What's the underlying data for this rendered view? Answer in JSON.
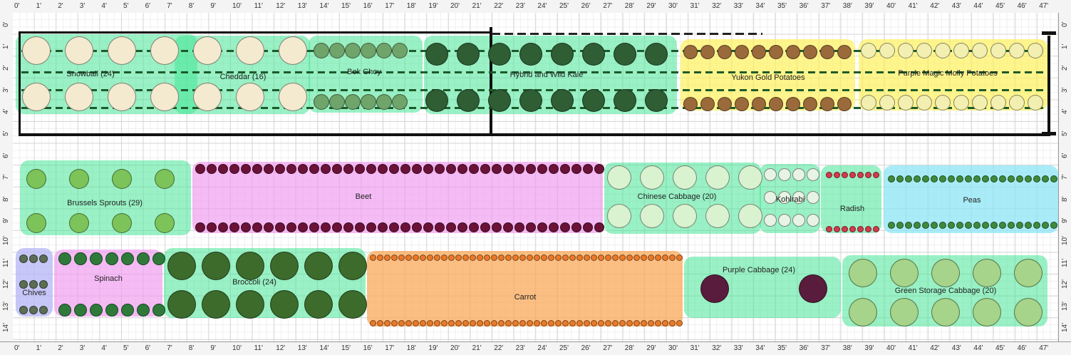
{
  "rulers": {
    "top": [
      "0'",
      "1'",
      "2'",
      "3'",
      "4'",
      "5'",
      "6'",
      "7'",
      "8'",
      "9'",
      "10'",
      "11'",
      "12'",
      "13'",
      "14'",
      "15'",
      "16'",
      "17'",
      "18'",
      "19'",
      "20'",
      "21'",
      "22'",
      "23'",
      "24'",
      "25'",
      "26'",
      "27'",
      "28'",
      "29'",
      "30'",
      "31'",
      "32'",
      "33'",
      "34'",
      "35'",
      "36'",
      "37'",
      "38'",
      "39'",
      "40'",
      "41'",
      "42'",
      "43'",
      "44'",
      "45'",
      "46'",
      "47'"
    ],
    "side": [
      "0'",
      "1'",
      "2'",
      "3'",
      "4'",
      "5'",
      "6'",
      "7'",
      "8'",
      "9'",
      "10'",
      "11'",
      "12'",
      "13'",
      "14'"
    ]
  },
  "beds": {
    "snowball": "Snowball (24)",
    "cheddar": "Cheddar (16)",
    "bok_choy": "Bok Choy",
    "kale": "Hybrid and Wild Kale",
    "yukon": "Yukon Gold Potatoes",
    "purple_potato": "Purple Magic Molly Potatoes",
    "brussels": "Brussels Sprouts (29)",
    "beet": "Beet",
    "chinese_cabbage": "Chinese Cabbage (20)",
    "kohlrabi": "Kohlrabi",
    "radish": "Radish",
    "peas": "Peas",
    "chives": "Chives",
    "spinach": "Spinach",
    "broccoli": "Broccoli (24)",
    "carrot": "Carrot",
    "purple_cabbage": "Purple Cabbage (24)",
    "green_cabbage": "Green Storage Cabbage (20)"
  },
  "colors": {
    "cauliflower": "#f3ead0",
    "bok_choy": "#6fa46a",
    "kale": "#2f5d34",
    "potato_yukon": "#9a6a3b",
    "potato_purple": "#f2efb0",
    "brussels": "#7cc35a",
    "beet": "#6b1238",
    "chinese_cabbage": "#d9f2cf",
    "kohlrabi": "#e7f3e4",
    "radish": "#d23b4b",
    "peas": "#3f8a3c",
    "chives": "#5b6e55",
    "spinach": "#2f7a3a",
    "broccoli": "#3c6b2c",
    "carrot": "#e87a2a",
    "purple_cabbage": "#5a1c3c",
    "green_cabbage": "#a5d48a"
  }
}
